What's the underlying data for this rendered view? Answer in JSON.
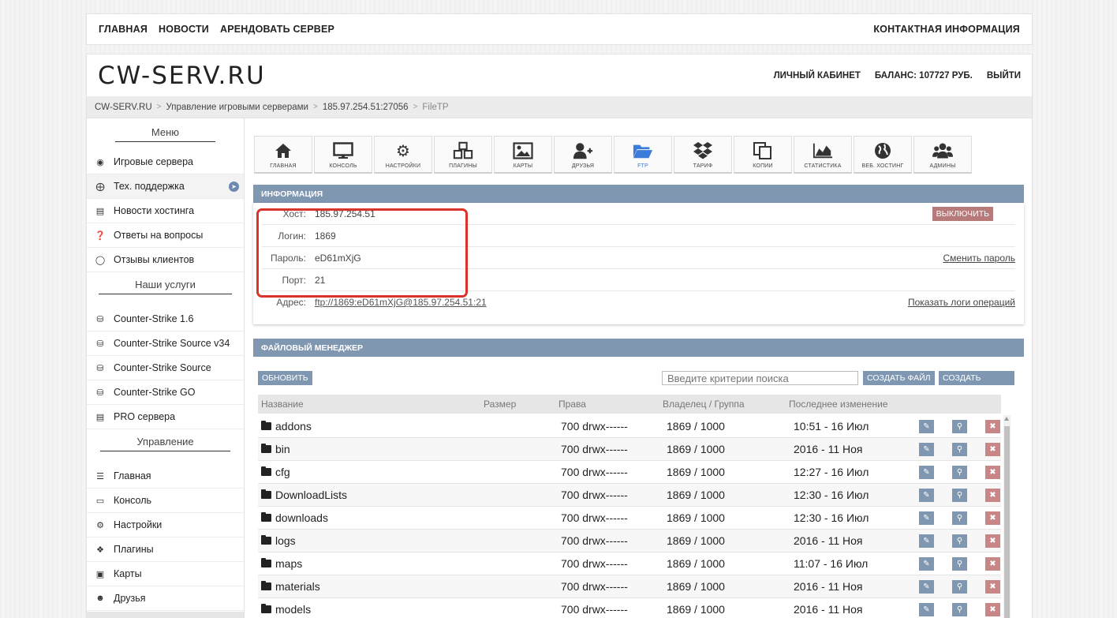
{
  "topnav": {
    "links": [
      "ГЛАВНАЯ",
      "НОВОСТИ",
      "АРЕНДОВАТЬ СЕРВЕР"
    ],
    "contact": "КОНТАКТНАЯ ИНФОРМАЦИЯ"
  },
  "header": {
    "logo": "CW-SERV.RU",
    "cabinet": "ЛИЧНЫЙ КАБИНЕТ",
    "balance": "БАЛАНС: 107727 РУБ.",
    "logout": "ВЫЙТИ"
  },
  "breadcrumb": [
    "CW-SERV.RU",
    "Управление игровыми серверами",
    "185.97.254.51:27056",
    "FileTP"
  ],
  "sidebar": {
    "menu_title": "Меню",
    "menu_items": [
      {
        "label": "Игровые сервера",
        "icon": "gamepad-icon"
      },
      {
        "label": "Тех. поддержка",
        "icon": "lifebuoy-icon"
      },
      {
        "label": "Новости хостинга",
        "icon": "newspaper-icon"
      },
      {
        "label": "Ответы на вопросы",
        "icon": "question-icon"
      },
      {
        "label": "Отзывы клиентов",
        "icon": "comments-icon"
      }
    ],
    "services_title": "Наши услуги",
    "service_items": [
      {
        "label": "Counter-Strike 1.6",
        "icon": "basket-icon"
      },
      {
        "label": "Counter-Strike Source v34",
        "icon": "basket-icon"
      },
      {
        "label": "Counter-Strike Source",
        "icon": "basket-icon"
      },
      {
        "label": "Counter-Strike GO",
        "icon": "basket-icon"
      },
      {
        "label": "PRO сервера",
        "icon": "server-icon"
      }
    ],
    "manage_title": "Управление",
    "manage_items": [
      {
        "label": "Главная",
        "icon": "bars-icon"
      },
      {
        "label": "Консоль",
        "icon": "monitor-icon"
      },
      {
        "label": "Настройки",
        "icon": "gear-icon"
      },
      {
        "label": "Плагины",
        "icon": "cubes-icon"
      },
      {
        "label": "Карты",
        "icon": "image-icon"
      },
      {
        "label": "Друзья",
        "icon": "user-plus-icon"
      }
    ]
  },
  "tabs": [
    {
      "label": "главная",
      "icon": "home-icon"
    },
    {
      "label": "консоль",
      "icon": "monitor-icon"
    },
    {
      "label": "настройки",
      "icon": "gear-icon"
    },
    {
      "label": "плагины",
      "icon": "cubes-icon"
    },
    {
      "label": "карты",
      "icon": "image-icon"
    },
    {
      "label": "друзья",
      "icon": "user-plus-icon"
    },
    {
      "label": "ftp",
      "icon": "folder-open-icon"
    },
    {
      "label": "тариф",
      "icon": "dropbox-icon"
    },
    {
      "label": "копии",
      "icon": "copy-icon"
    },
    {
      "label": "статистика",
      "icon": "area-chart-icon"
    },
    {
      "label": "веб. хостинг",
      "icon": "globe-icon"
    },
    {
      "label": "админы",
      "icon": "users-icon"
    }
  ],
  "active_tab": "ftp",
  "info": {
    "title": "ИНФОРМАЦИЯ",
    "host_label": "Хост:",
    "host": "185.97.254.51",
    "login_label": "Логин:",
    "login": "1869",
    "password_label": "Пароль:",
    "password": "eD61mXjG",
    "port_label": "Порт:",
    "port": "21",
    "address_label": "Адрес:",
    "address": "ftp://1869:eD61mXjG@185.97.254.51:21",
    "disable_btn": "ВЫКЛЮЧИТЬ",
    "change_password": "Сменить пароль",
    "show_logs": "Показать логи операций"
  },
  "fm": {
    "title": "ФАЙЛОВЫЙ МЕНЕДЖЕР",
    "refresh": "ОБНОВИТЬ",
    "search_placeholder": "Введите критерии поиска",
    "create_file": "СОЗДАТЬ ФАЙЛ",
    "create_folder": "СОЗДАТЬ ПАПКУ",
    "columns": [
      "Название",
      "Размер",
      "Права",
      "Владелец / Группа",
      "Последнее изменение"
    ],
    "rows": [
      {
        "name": "addons",
        "rights": "700 drwx------",
        "owner": "1869 / 1000",
        "modified": "10:51 - 16 Июл"
      },
      {
        "name": "bin",
        "rights": "700 drwx------",
        "owner": "1869 / 1000",
        "modified": "2016 - 11 Ноя"
      },
      {
        "name": "cfg",
        "rights": "700 drwx------",
        "owner": "1869 / 1000",
        "modified": "12:27 - 16 Июл"
      },
      {
        "name": "DownloadLists",
        "rights": "700 drwx------",
        "owner": "1869 / 1000",
        "modified": "12:30 - 16 Июл"
      },
      {
        "name": "downloads",
        "rights": "700 drwx------",
        "owner": "1869 / 1000",
        "modified": "12:30 - 16 Июл"
      },
      {
        "name": "logs",
        "rights": "700 drwx------",
        "owner": "1869 / 1000",
        "modified": "2016 - 11 Ноя"
      },
      {
        "name": "maps",
        "rights": "700 drwx------",
        "owner": "1869 / 1000",
        "modified": "11:07 - 16 Июл"
      },
      {
        "name": "materials",
        "rights": "700 drwx------",
        "owner": "1869 / 1000",
        "modified": "2016 - 11 Ноя"
      },
      {
        "name": "models",
        "rights": "700 drwx------",
        "owner": "1869 / 1000",
        "modified": "2016 - 11 Ноя"
      }
    ]
  },
  "colors": {
    "accent": "#8097b2",
    "danger": "#c98686",
    "active_tab": "#3b7bd9",
    "highlight": "#d9332b"
  }
}
